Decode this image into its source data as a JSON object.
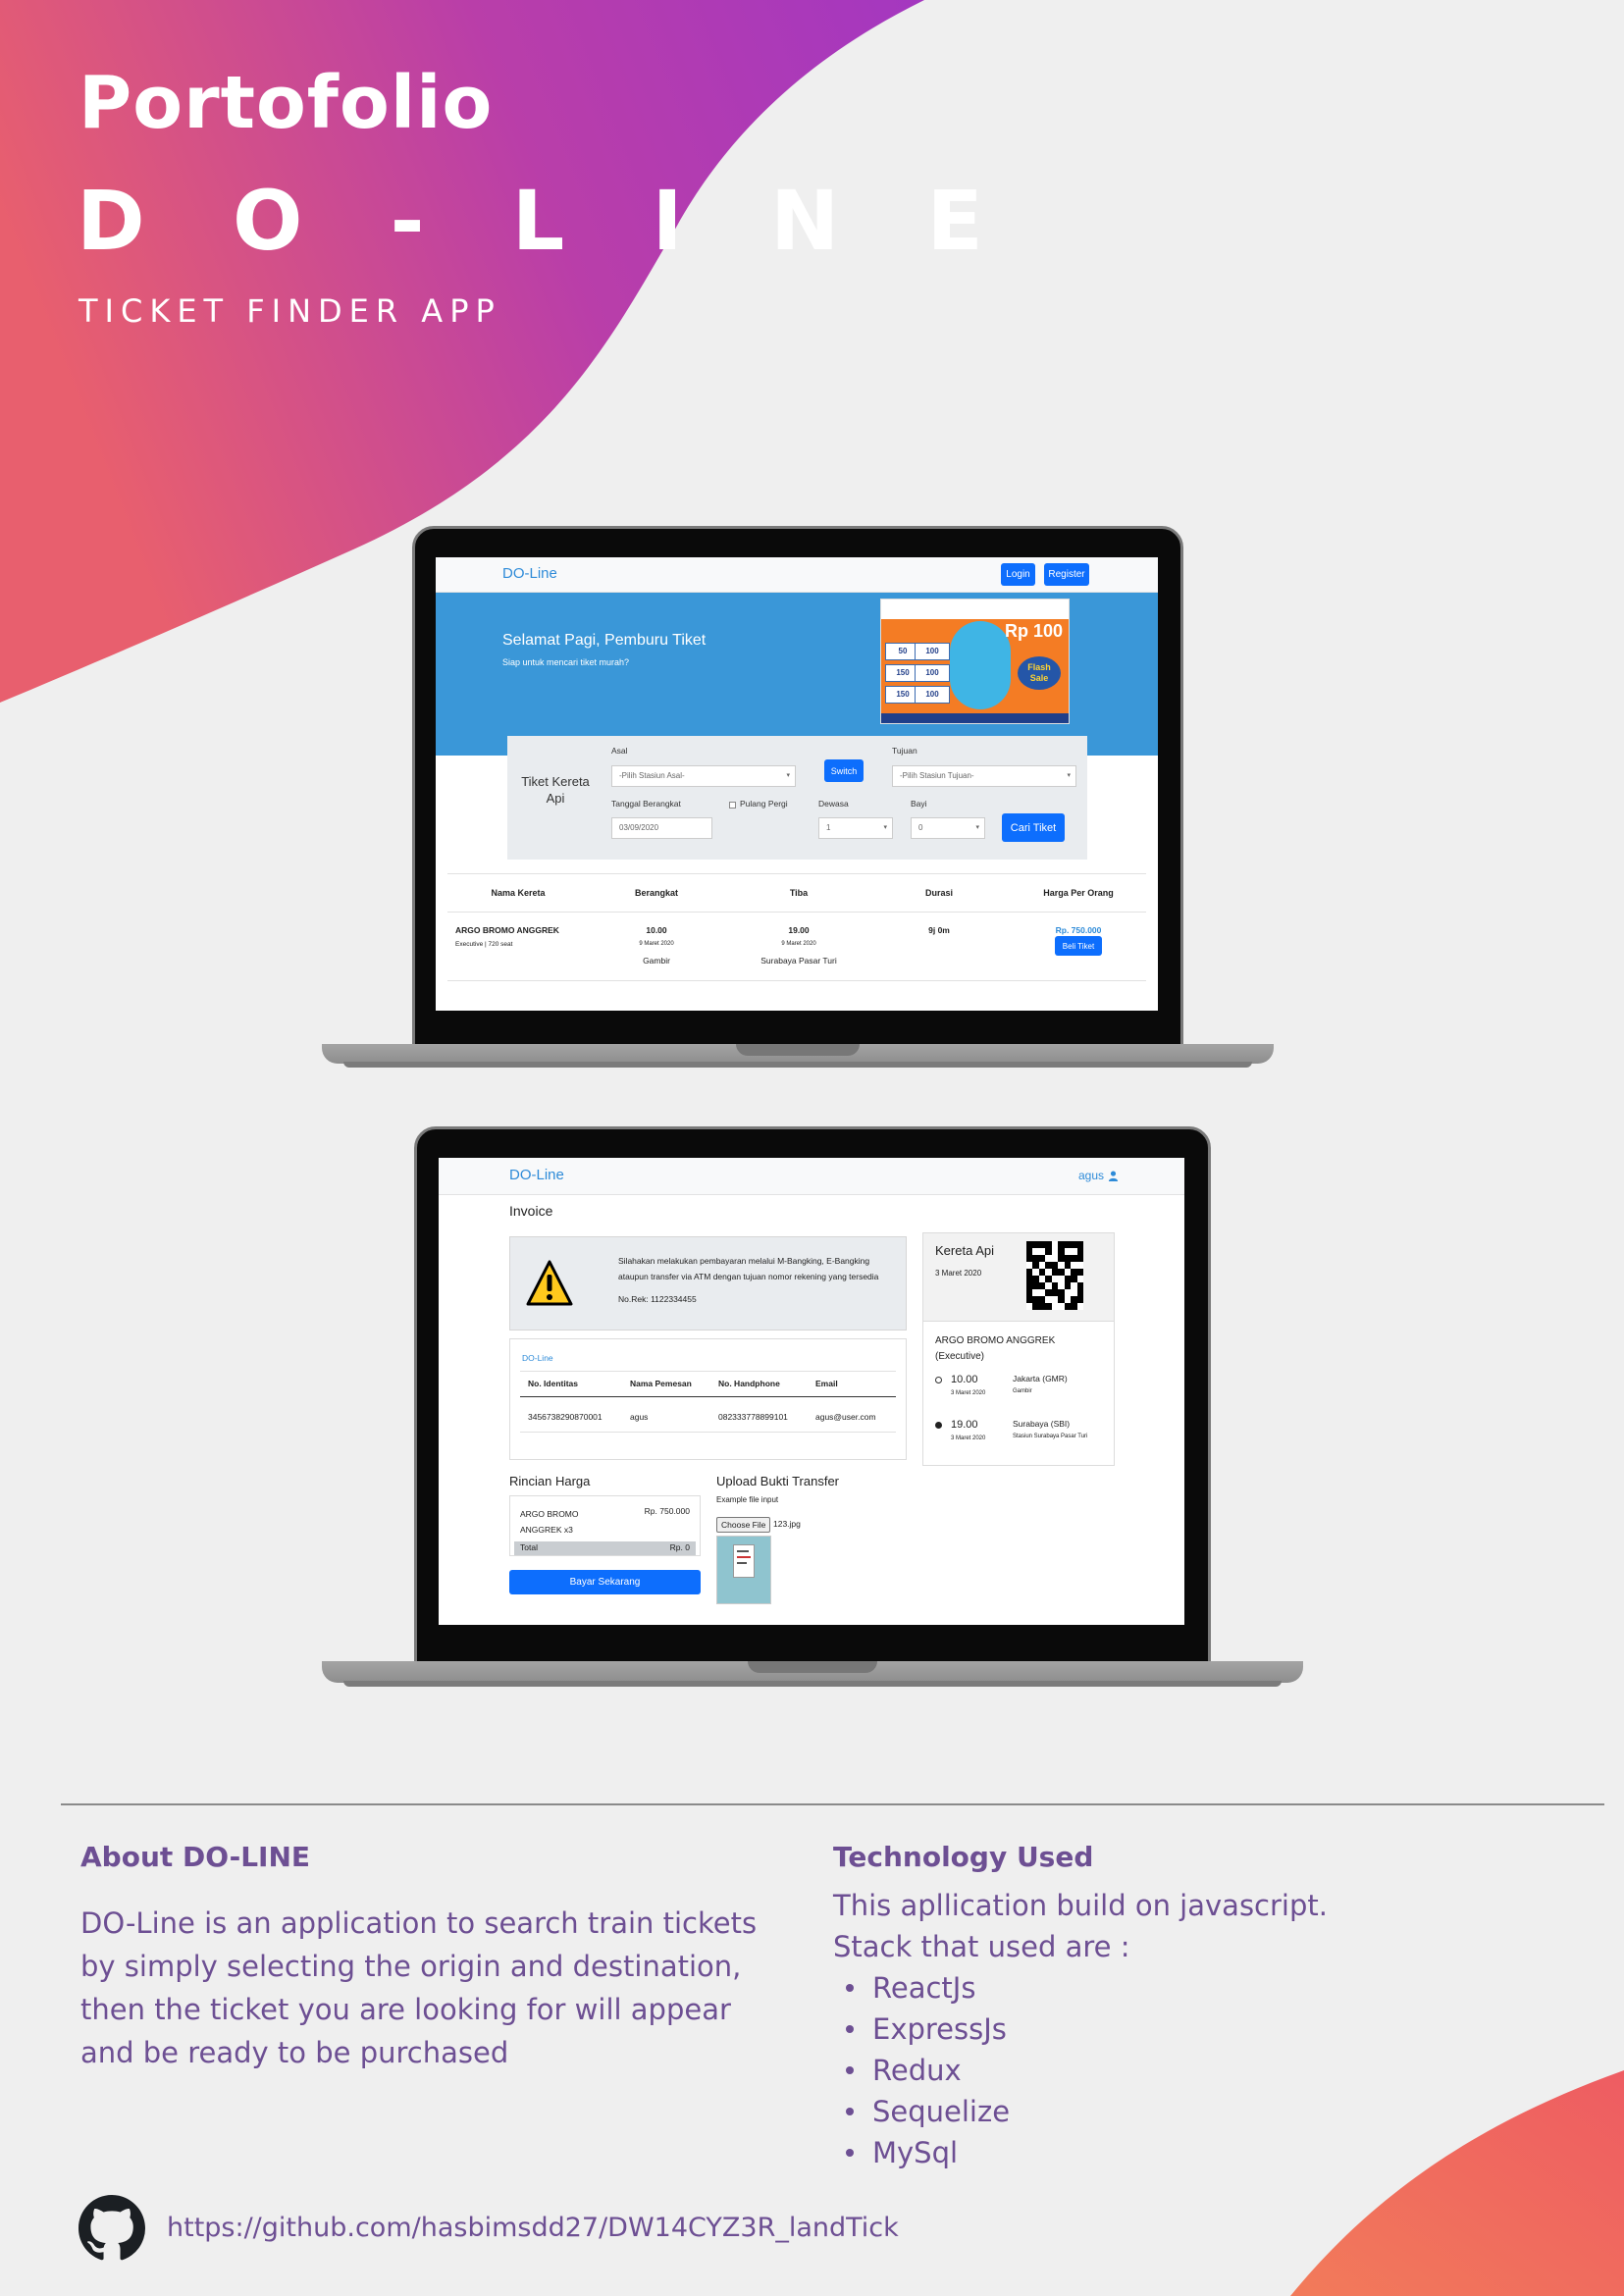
{
  "header": {
    "title": "Portofolio",
    "brand": "D O - L I N E",
    "subtitle": "TICKET FINDER APP"
  },
  "colors": {
    "gradient_start": "#e85f6e",
    "gradient_end": "#a437c0",
    "accent_purple": "#6d4f93",
    "primary_blue": "#0d6efd",
    "jumbotron_blue": "#3a97d8"
  },
  "screen1": {
    "brand": "DO-Line",
    "login_label": "Login",
    "register_label": "Register",
    "greeting": "Selamat Pagi, Pemburu Tiket",
    "greeting_sub": "Siap untuk mencari tiket murah?",
    "promo": {
      "tags": [
        "50",
        "100",
        "150",
        "100",
        "150",
        "100"
      ],
      "headline": "Rp 100",
      "flash": "Flash Sale"
    },
    "search": {
      "title": "Tiket Kereta Api",
      "asal_label": "Asal",
      "asal_placeholder": "-Pilih Stasiun Asal-",
      "switch_label": "Switch",
      "tujuan_label": "Tujuan",
      "tujuan_placeholder": "-Pilih Stasiun Tujuan-",
      "tanggal_label": "Tanggal Berangkat",
      "tanggal_value": "03/09/2020",
      "pulang_pergi_label": "Pulang Pergi",
      "dewasa_label": "Dewasa",
      "dewasa_value": "1",
      "bayi_label": "Bayi",
      "bayi_value": "0",
      "submit_label": "Cari Tiket"
    },
    "table": {
      "headers": [
        "Nama Kereta",
        "Berangkat",
        "Tiba",
        "Durasi",
        "Harga Per Orang"
      ],
      "row": {
        "name": "ARGO BROMO ANGGREK",
        "class": "Executive | 720 seat",
        "depart_time": "10.00",
        "depart_date": "9 Maret 2020",
        "depart_station": "Gambir",
        "arrive_time": "19.00",
        "arrive_date": "9 Maret 2020",
        "arrive_station": "Surabaya Pasar Turi",
        "duration": "9j 0m",
        "price": "Rp. 750.000",
        "buy_label": "Beli Tiket"
      }
    }
  },
  "screen2": {
    "brand": "DO-Line",
    "user": "agus",
    "page_title": "Invoice",
    "warning_text": "Silahakan melakukan pembayaran melalui M-Bangking, E-Bangking ataupun transfer via ATM dengan tujuan nomor rekening yang tersedia",
    "account": "No.Rek: 1122334455",
    "customer_brand": "DO-Line",
    "customer_headers": [
      "No. Identitas",
      "Nama Pemesan",
      "No. Handphone",
      "Email"
    ],
    "customer_row": [
      "3456738290870001",
      "agus",
      "082333778899101",
      "agus@user.com"
    ],
    "ticket": {
      "title": "Kereta Api",
      "date": "3 Maret 2020",
      "train": "ARGO BROMO ANGGREK (Executive)",
      "depart_time": "10.00",
      "depart_date": "3 Maret 2020",
      "depart_city": "Jakarta (GMR)",
      "depart_station": "Gambir",
      "arrive_time": "19.00",
      "arrive_date": "3 Maret 2020",
      "arrive_city": "Surabaya (SBI)",
      "arrive_station": "Stasiun Surabaya Pasar Turi"
    },
    "rincian_title": "Rincian Harga",
    "rincian_item": "ARGO BROMO ANGGREK x3",
    "rincian_price": "Rp. 750.000",
    "total_label": "Total",
    "total_value": "Rp. 0",
    "pay_label": "Bayar Sekarang",
    "upload_title": "Upload Bukti Transfer",
    "upload_hint": "Example file input",
    "choose_file_label": "Choose File",
    "file_name": "123.jpg"
  },
  "about": {
    "heading": "About DO-LINE",
    "body": "DO-Line is an application to search  train tickets by simply selecting the origin and destination, then the ticket you are looking for will appear and be ready to be purchased"
  },
  "technology": {
    "heading": "Technology Used",
    "intro_1": "This apllication build on javascript.",
    "intro_2": "Stack that used are :",
    "stack": [
      "ReactJs",
      "ExpressJs",
      "Redux",
      "Sequelize",
      "MySql"
    ]
  },
  "footer": {
    "icon": "github-icon",
    "link": "https://github.com/hasbimsdd27/DW14CYZ3R_landTick"
  }
}
